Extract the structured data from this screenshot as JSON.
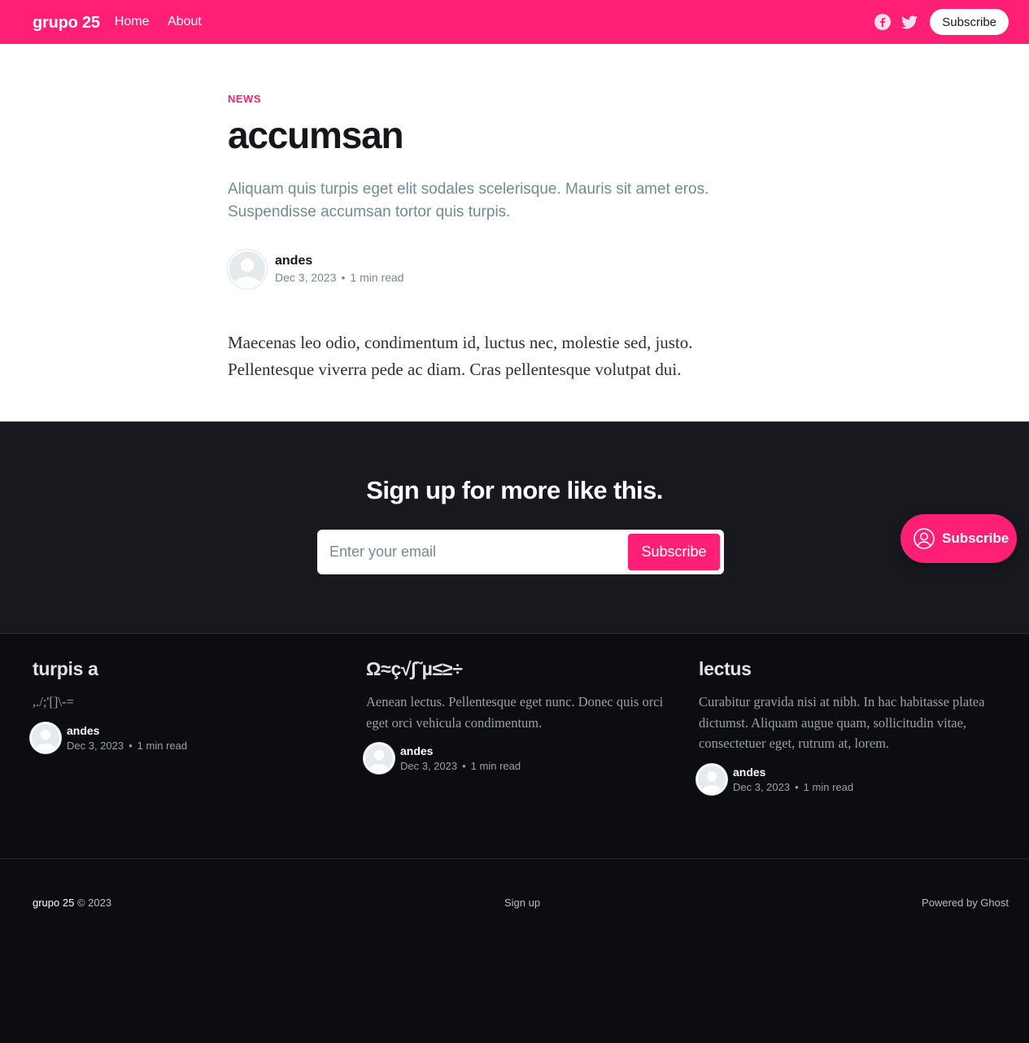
{
  "header": {
    "brand": "grupo 25",
    "nav": [
      "Home",
      "About"
    ],
    "subscribe_label": "Subscribe",
    "social": [
      "facebook-icon",
      "twitter-icon"
    ],
    "accent_color": "#ff1f75"
  },
  "article": {
    "tag": "NEWS",
    "title": "accumsan",
    "excerpt": "Aliquam quis turpis eget elit sodales scelerisque. Mauris sit amet eros. Suspendisse accumsan tortor quis turpis.",
    "author": "andes",
    "date": "Dec 3, 2023",
    "dot": "•",
    "read_time": "1 min read",
    "body": "Maecenas leo odio, condimentum id, luctus nec, molestie sed, justo. Pellentesque viverra pede ac diam. Cras pellentesque volutpat dui."
  },
  "signup": {
    "heading": "Sign up for more like this.",
    "email_placeholder": "Enter your email",
    "button_label": "Subscribe"
  },
  "portal": {
    "label": "Subscribe"
  },
  "related": [
    {
      "title": "turpis a",
      "excerpt": ",./;'[]\\-=",
      "author": "andes",
      "date": "Dec 3, 2023",
      "dot": "•",
      "read_time": "1 min read"
    },
    {
      "title": "Ω≈ç√∫˜µ≤≥÷",
      "excerpt": "Aenean lectus. Pellentesque eget nunc. Donec quis orci eget orci vehicula condimentum.",
      "author": "andes",
      "date": "Dec 3, 2023",
      "dot": "•",
      "read_time": "1 min read"
    },
    {
      "title": "lectus",
      "excerpt": "Curabitur gravida nisi at nibh. In hac habitasse platea dictumst. Aliquam augue quam, sollicitudin vitae, consectetuer eget, rutrum at, lorem.",
      "author": "andes",
      "date": "Dec 3, 2023",
      "dot": "•",
      "read_time": "1 min read"
    }
  ],
  "footer": {
    "brand": "grupo 25",
    "copyright": "© 2023",
    "signup_link": "Sign up",
    "powered": "Powered by Ghost"
  }
}
